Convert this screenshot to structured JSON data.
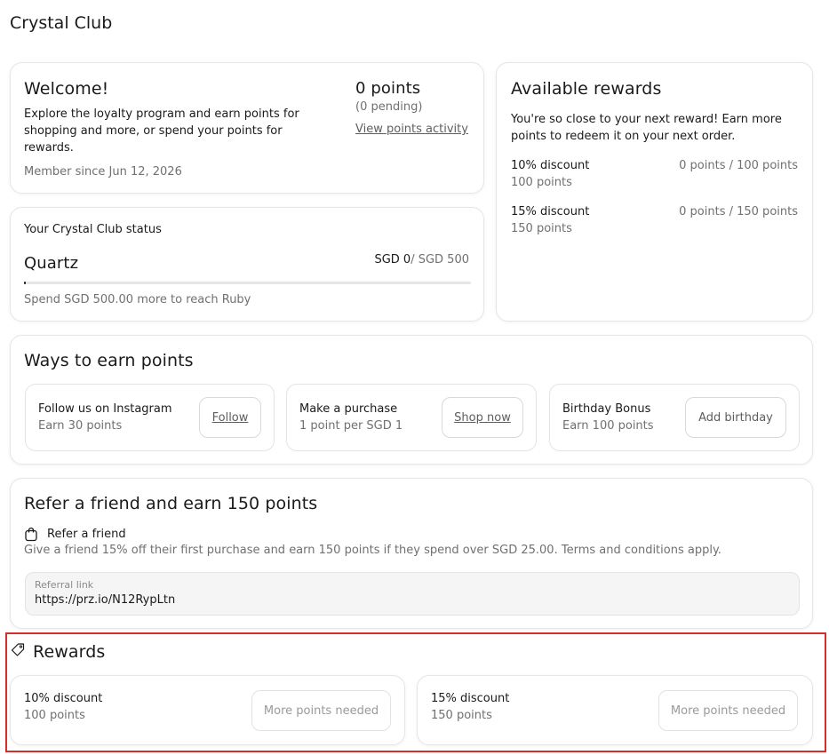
{
  "app": {
    "title": "Crystal Club"
  },
  "welcome": {
    "title": "Welcome!",
    "description": "Explore the loyalty program and earn points for shopping and more, or spend your points for rewards.",
    "member_since": "Member since Jun 12, 2026",
    "points": "0 points",
    "pending": "(0 pending)",
    "activity_link": "View points activity"
  },
  "status": {
    "heading": "Your Crystal Club status",
    "tier": "Quartz",
    "spend_current": "SGD 0",
    "spend_target": "/ SGD 500",
    "progress_fraction": 0,
    "next_tier_text": "Spend SGD 500.00 more to reach Ruby"
  },
  "available_rewards": {
    "title": "Available rewards",
    "description": "You're so close to your next reward! Earn more points to redeem it on your next order.",
    "items": [
      {
        "name": "10% discount",
        "points": "100 points",
        "progress": "0 points / 100 points"
      },
      {
        "name": "15% discount",
        "points": "150 points",
        "progress": "0 points / 150 points"
      }
    ]
  },
  "earn": {
    "title": "Ways to earn points",
    "items": [
      {
        "title": "Follow us on Instagram",
        "subtitle": "Earn 30 points",
        "button": "Follow"
      },
      {
        "title": "Make a purchase",
        "subtitle": "1 point per SGD 1",
        "button": "Shop now"
      },
      {
        "title": "Birthday Bonus",
        "subtitle": "Earn 100 points",
        "button": "Add birthday"
      }
    ]
  },
  "referral": {
    "title": "Refer a friend and earn 150 points",
    "subtitle": "Refer a friend",
    "description": "Give a friend 15% off their first purchase and earn 150 points if they spend over SGD 25.00. Terms and conditions apply.",
    "link_label": "Referral link",
    "link_value": "https://prz.io/N12RypLtn"
  },
  "rewards": {
    "title": "Rewards",
    "highlight_color": "#d32f2f",
    "items": [
      {
        "name": "10% discount",
        "points": "100 points",
        "button": "More points needed"
      },
      {
        "name": "15% discount",
        "points": "150 points",
        "button": "More points needed"
      }
    ]
  }
}
